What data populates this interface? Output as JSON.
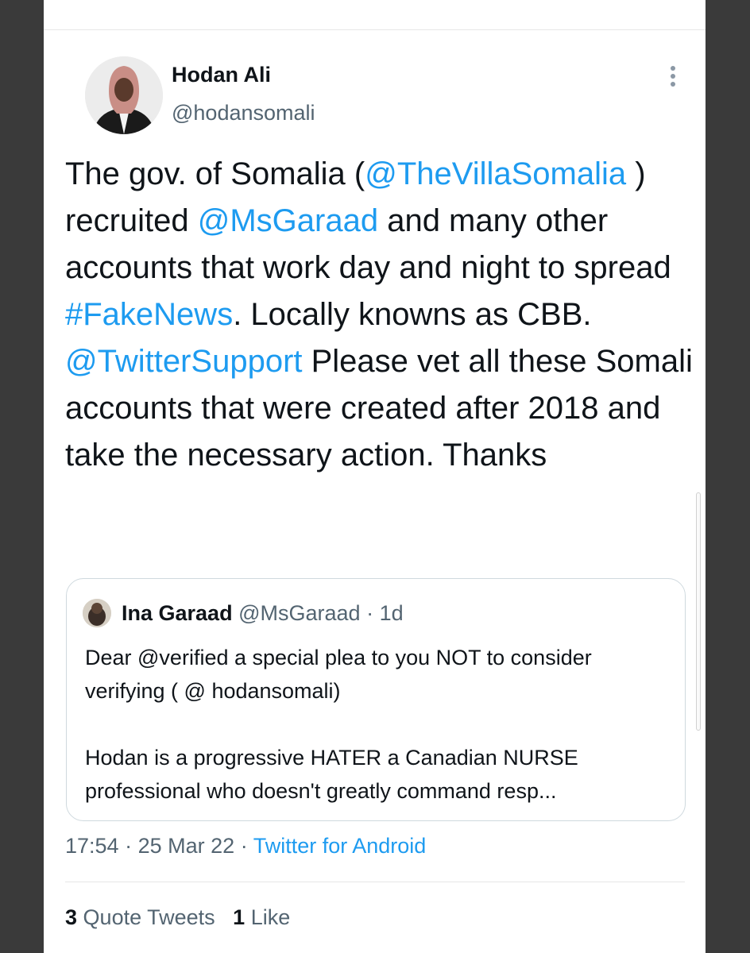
{
  "author": {
    "display_name": "Hodan Ali",
    "handle": "@hodansomali"
  },
  "tweet": {
    "segments": [
      {
        "text": "The gov. of Somalia (",
        "type": "text"
      },
      {
        "text": "@TheVillaSomalia",
        "type": "link"
      },
      {
        "text": " ) recruited ",
        "type": "text"
      },
      {
        "text": "@MsGaraad",
        "type": "link"
      },
      {
        "text": " and many other accounts that work day and night to spread ",
        "type": "text"
      },
      {
        "text": "#FakeNews",
        "type": "link"
      },
      {
        "text": ". Locally knowns as CBB. ",
        "type": "text"
      },
      {
        "text": "@TwitterSupport",
        "type": "link"
      },
      {
        "text": " Please vet all these Somali accounts that were created after 2018 and take the necessary action. Thanks",
        "type": "text"
      }
    ]
  },
  "quote": {
    "display_name": "Ina Garaad",
    "handle": "@MsGaraad",
    "sep": "·",
    "time": "1d",
    "paragraph1": "Dear @verified a special plea to you NOT to consider verifying ( @ hodansomali)",
    "paragraph2": "Hodan is a progressive HATER a Canadian NURSE professional who doesn't greatly command resp..."
  },
  "meta": {
    "time": "17:54",
    "sep": "·",
    "date": "25 Mar 22",
    "source": "Twitter for Android"
  },
  "stats": {
    "quote_count": "3",
    "quote_label": "Quote Tweets",
    "like_count": "1",
    "like_label": "Like"
  },
  "colors": {
    "link": "#1d9bf0",
    "secondary_text": "#536471",
    "primary_text": "#0f1419",
    "frame": "#3a3a3a"
  },
  "icons": {
    "more": "vertical-ellipsis-icon"
  }
}
